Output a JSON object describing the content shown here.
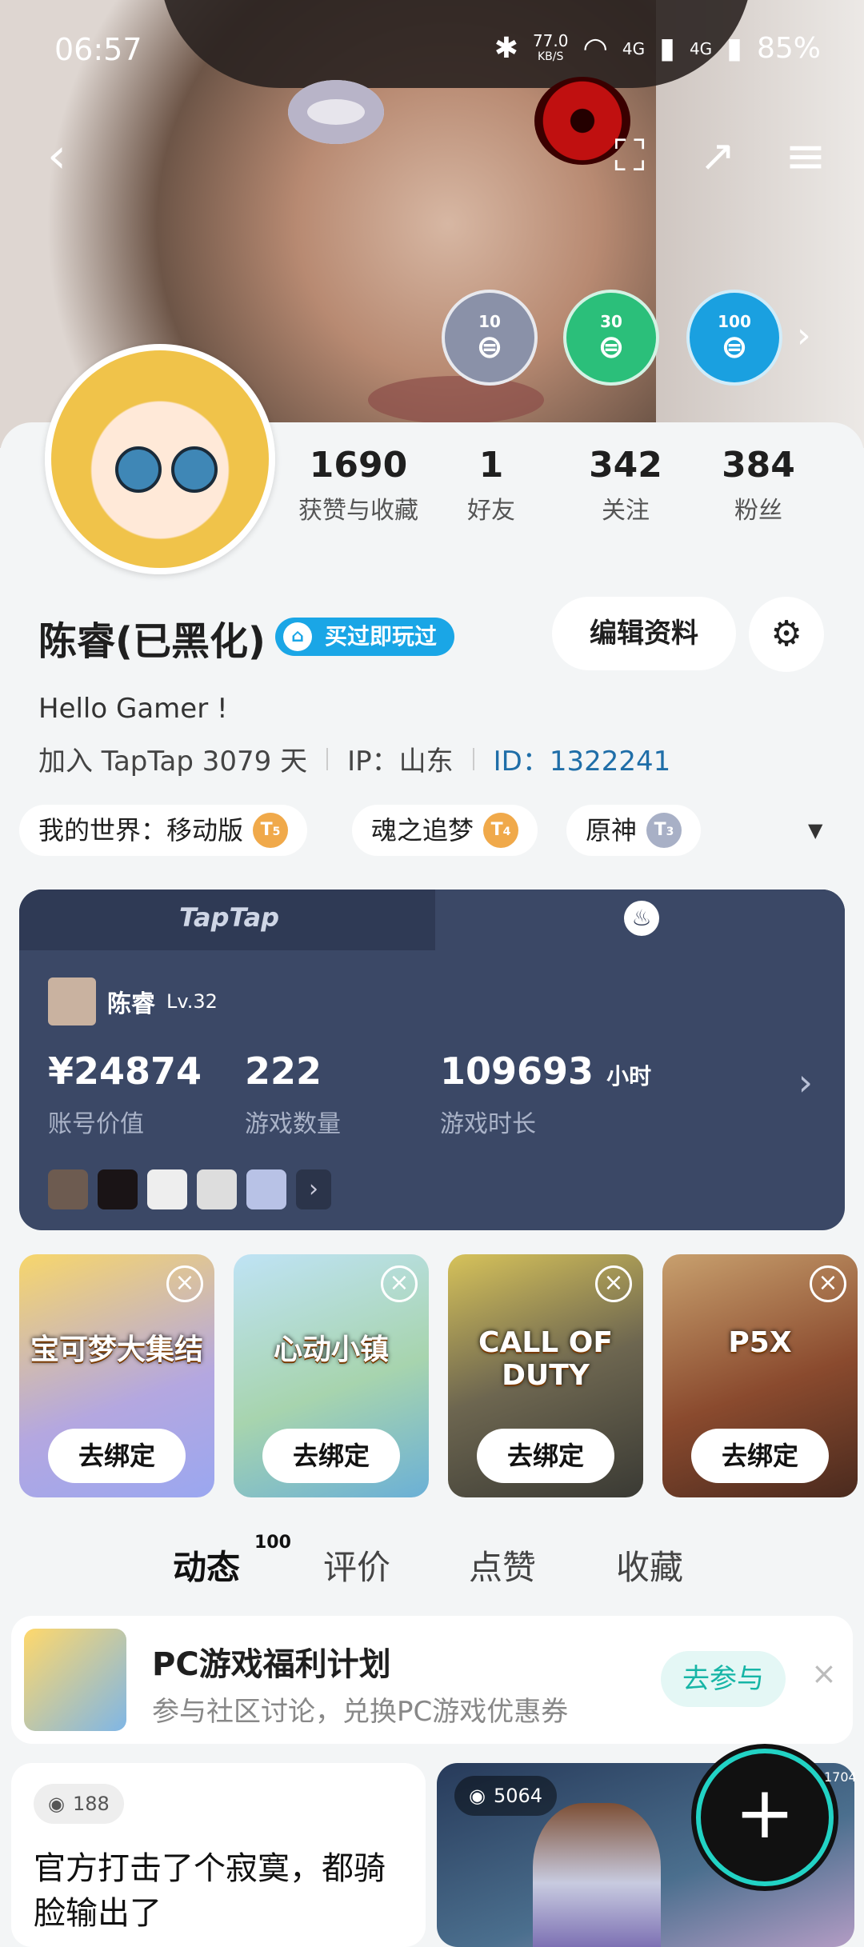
{
  "status": {
    "time": "06:57",
    "speed_value": "77.0",
    "speed_unit": "KB/S",
    "net1": "4G",
    "net2": "4G",
    "battery": "85%"
  },
  "toolbar": {
    "back_icon": "‹",
    "scan_icon": "⛶",
    "share_icon": "↗",
    "menu_icon": "≡"
  },
  "badges": [
    {
      "n": "10",
      "color": "#8a91a8"
    },
    {
      "n": "30",
      "color": "#2bbf7a"
    },
    {
      "n": "100",
      "color": "#1aa0e0"
    }
  ],
  "badge_more": "›",
  "stats": [
    {
      "value": "1690",
      "label": "获赞与收藏"
    },
    {
      "value": "1",
      "label": "好友"
    },
    {
      "value": "342",
      "label": "关注"
    },
    {
      "value": "384",
      "label": "粉丝"
    }
  ],
  "profile": {
    "name": "陈睿(已黑化)",
    "buy_tag": "买过即玩过",
    "edit_label": "编辑资料",
    "bio": "Hello Gamer !",
    "joined": "加入 TapTap 3079 天",
    "ip": "IP：山东",
    "id": "ID：1322241"
  },
  "game_chips": [
    {
      "name": "我的世界：移动版",
      "tier": "5",
      "color": "#f0a94a"
    },
    {
      "name": "魂之追梦",
      "tier": "4",
      "color": "#f0a94a"
    },
    {
      "name": "原神",
      "tier": "3",
      "color": "#a8b0c6"
    }
  ],
  "chip_more": "▼",
  "steam": {
    "tab_taptap": "TapTap",
    "user": "陈睿",
    "level": "Lv.32",
    "value_amount": "¥24874",
    "value_label": "账号价值",
    "games_count": "222",
    "games_label": "游戏数量",
    "hours": "109693",
    "hours_unit": "小时",
    "hours_label": "游戏时长",
    "arrow": "›",
    "more_icon": "›"
  },
  "bind_cards": [
    {
      "title": "宝可梦大集结",
      "action": "去绑定",
      "bg": "linear-gradient(160deg,#f7d66b,#b4a7e0 60%,#9aa7f0)"
    },
    {
      "title": "心动小镇",
      "action": "去绑定",
      "bg": "linear-gradient(160deg,#bfe3f5,#a7d4ae 55%,#6bb0d6)"
    },
    {
      "title": "CALL OF DUTY",
      "action": "去绑定",
      "bg": "linear-gradient(160deg,#d6c25a,#6d6650 50%,#3a3a34)"
    },
    {
      "title": "P5X",
      "action": "去绑定",
      "bg": "linear-gradient(160deg,#c8a06e,#8a4a2e 55%,#4a2a1e)"
    }
  ],
  "close_icon": "×",
  "tabs": [
    {
      "label": "动态",
      "count": "100"
    },
    {
      "label": "评价"
    },
    {
      "label": "点赞"
    },
    {
      "label": "收藏"
    }
  ],
  "promo": {
    "title": "PC游戏福利计划",
    "subtitle": "参与社区讨论，兑换PC游戏优惠券",
    "action": "去参与",
    "close": "×"
  },
  "posts": [
    {
      "views": "188",
      "text": "官方打击了个寂寞，都骑脸输出了"
    },
    {
      "views": "5064"
    }
  ],
  "eye_icon": "◉",
  "fab": {
    "icon": "+",
    "tag": "1704"
  }
}
